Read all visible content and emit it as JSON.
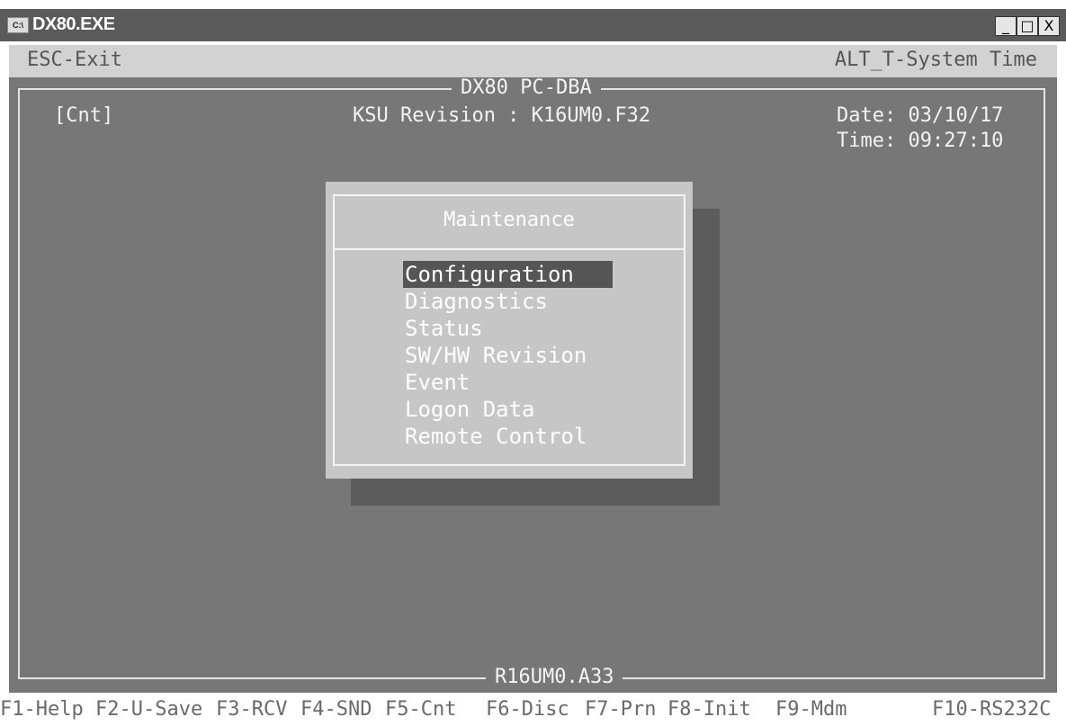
{
  "window": {
    "icon_label": "C:\\",
    "title": "DX80.EXE",
    "controls": {
      "minimize": "_",
      "maximize": "□",
      "close": "X"
    }
  },
  "hint_bar": {
    "left": "ESC-Exit",
    "right": "ALT_T-System Time"
  },
  "screen": {
    "frame_title": "DX80 PC-DBA",
    "mode": "[Cnt]",
    "ksu_revision": "KSU Revision : K16UM0.F32",
    "date": "Date: 03/10/17",
    "time": "Time: 09:27:10",
    "footer_label": "R16UM0.A33"
  },
  "dialog": {
    "title": "Maintenance",
    "selected_index": 0,
    "items": [
      {
        "label": "Configuration"
      },
      {
        "label": "Diagnostics"
      },
      {
        "label": "Status"
      },
      {
        "label": "SW/HW Revision"
      },
      {
        "label": "Event"
      },
      {
        "label": "Logon Data"
      },
      {
        "label": "Remote Control"
      }
    ]
  },
  "function_keys": [
    {
      "label": "F1-Help"
    },
    {
      "label": "F2-U-Save"
    },
    {
      "label": "F3-RCV"
    },
    {
      "label": "F4-SND"
    },
    {
      "label": "F5-Cnt"
    },
    {
      "label": "F6-Disc"
    },
    {
      "label": "F7-Prn"
    },
    {
      "label": "F8-Init"
    },
    {
      "label": "F9-Mdm"
    },
    {
      "label": "F10-RS232C"
    }
  ]
}
